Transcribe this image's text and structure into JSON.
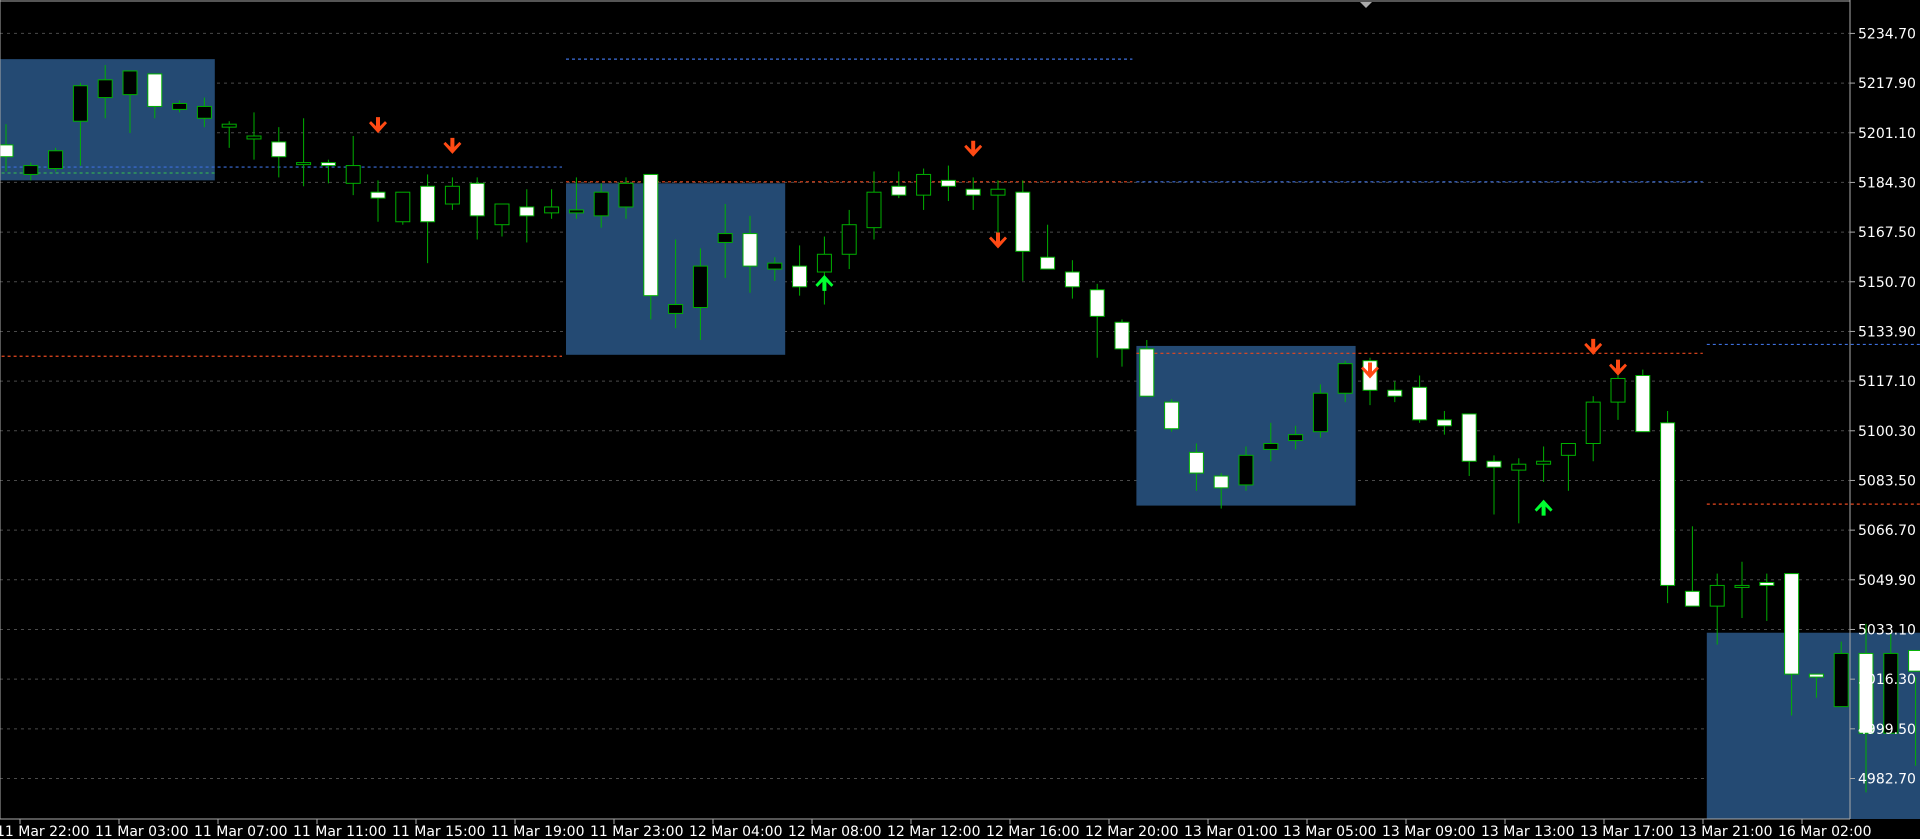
{
  "chart_data": {
    "type": "candlestick",
    "colors": {
      "background": "#000000",
      "bull_body": "#000000",
      "bear_body": "#ffffff",
      "wick": "#00b000",
      "grid": "#4a4a4a",
      "zone": "#244a73",
      "level_blue": "#3d6fdc",
      "level_red": "#e8481f",
      "level_green": "#33aa55",
      "arrow_down": "#ff4a14",
      "arrow_up": "#00ff30",
      "text": "#ffffff",
      "axis": "#aaaaaa"
    },
    "ylim": [
      4969,
      5246
    ],
    "y_ticks": [
      "5234.70",
      "5217.90",
      "5201.10",
      "5184.30",
      "5167.50",
      "5150.70",
      "5133.90",
      "5117.10",
      "5100.30",
      "5083.50",
      "5066.70",
      "5049.90",
      "5033.10",
      "5016.30",
      "4999.50",
      "4982.70"
    ],
    "x_ticks": [
      "11 Mar 22:00",
      "11 Mar 03:00",
      "11 Mar 07:00",
      "11 Mar 11:00",
      "11 Mar 15:00",
      "11 Mar 19:00",
      "11 Mar 23:00",
      "12 Mar 04:00",
      "12 Mar 08:00",
      "12 Mar 12:00",
      "12 Mar 16:00",
      "12 Mar 20:00",
      "13 Mar 01:00",
      "13 Mar 05:00",
      "13 Mar 09:00",
      "13 Mar 13:00",
      "13 Mar 17:00",
      "13 Mar 21:00",
      "16 Mar 02:00"
    ],
    "candles": [
      [
        5197,
        5204,
        5188,
        5193
      ],
      [
        5187,
        5191,
        5185,
        5190
      ],
      [
        5189,
        5196,
        5188,
        5195
      ],
      [
        5205,
        5218,
        5190,
        5217
      ],
      [
        5213,
        5224,
        5206,
        5219
      ],
      [
        5214,
        5222,
        5201,
        5222
      ],
      [
        5221,
        5221,
        5206,
        5210
      ],
      [
        5209,
        5212,
        5208,
        5211
      ],
      [
        5206,
        5213,
        5203,
        5210
      ],
      [
        5203,
        5205,
        5196,
        5204
      ],
      [
        5199,
        5208,
        5192,
        5200
      ],
      [
        5198,
        5203,
        5186,
        5193
      ],
      [
        5191,
        5206,
        5183,
        5191
      ],
      [
        5191,
        5192,
        5184,
        5190
      ],
      [
        5184,
        5200,
        5180,
        5190
      ],
      [
        5181,
        5185,
        5171,
        5179
      ],
      [
        5171,
        5181,
        5170,
        5181
      ],
      [
        5183,
        5187,
        5157,
        5171
      ],
      [
        5177,
        5186,
        5175,
        5183
      ],
      [
        5184,
        5186,
        5165,
        5173
      ],
      [
        5170,
        5177,
        5166,
        5177
      ],
      [
        5176,
        5182,
        5164,
        5173
      ],
      [
        5174,
        5182,
        5172,
        5176
      ],
      [
        5174,
        5186,
        5172,
        5175
      ],
      [
        5173,
        5184,
        5169,
        5181
      ],
      [
        5176,
        5186,
        5172,
        5184
      ],
      [
        5187,
        5184,
        5138,
        5146
      ],
      [
        5140,
        5165,
        5135,
        5143
      ],
      [
        5142,
        5162,
        5131,
        5156
      ],
      [
        5164,
        5177,
        5152,
        5167
      ],
      [
        5167,
        5173,
        5147,
        5156
      ],
      [
        5155,
        5159,
        5151,
        5157
      ],
      [
        5156,
        5163,
        5146,
        5149
      ],
      [
        5154,
        5166,
        5143,
        5160
      ],
      [
        5160,
        5175,
        5155,
        5170
      ],
      [
        5169,
        5188,
        5165,
        5181
      ],
      [
        5183,
        5188,
        5179,
        5180
      ],
      [
        5180,
        5189,
        5175,
        5187
      ],
      [
        5185,
        5190,
        5178,
        5183
      ],
      [
        5182,
        5186,
        5175,
        5180
      ],
      [
        5180,
        5185,
        5167,
        5182
      ],
      [
        5181,
        5185,
        5151,
        5161
      ],
      [
        5159,
        5170,
        5155,
        5155
      ],
      [
        5154,
        5158,
        5145,
        5149
      ],
      [
        5148,
        5150,
        5125,
        5139
      ],
      [
        5137,
        5138,
        5122,
        5128
      ],
      [
        5128,
        5131,
        5112,
        5112
      ],
      [
        5110,
        5111,
        5100,
        5101
      ],
      [
        5093,
        5096,
        5080,
        5086
      ],
      [
        5085,
        5086,
        5074,
        5081
      ],
      [
        5082,
        5095,
        5080,
        5092
      ],
      [
        5094,
        5103,
        5090,
        5096
      ],
      [
        5097,
        5102,
        5094,
        5099
      ],
      [
        5100,
        5116,
        5098,
        5113
      ],
      [
        5113,
        5124,
        5110,
        5123
      ],
      [
        5124,
        5125,
        5109,
        5114
      ],
      [
        5114,
        5117,
        5110,
        5112
      ],
      [
        5115,
        5119,
        5103,
        5104
      ],
      [
        5104,
        5107,
        5099,
        5102
      ],
      [
        5106,
        5105,
        5085,
        5090
      ],
      [
        5090,
        5092,
        5072,
        5088
      ],
      [
        5087,
        5091,
        5069,
        5089
      ],
      [
        5089,
        5095,
        5083,
        5090
      ],
      [
        5092,
        5096,
        5080,
        5096
      ],
      [
        5096,
        5112,
        5090,
        5110
      ],
      [
        5110,
        5124,
        5104,
        5118
      ],
      [
        5119,
        5121,
        5101,
        5100
      ],
      [
        5103,
        5107,
        5042,
        5048
      ],
      [
        5046,
        5068,
        5041,
        5041
      ],
      [
        5041,
        5052,
        5028,
        5048
      ],
      [
        5048,
        5056,
        5037,
        5048
      ],
      [
        5049,
        5052,
        5036,
        5048
      ],
      [
        5052,
        5050,
        5004,
        5018
      ],
      [
        5018,
        5018,
        5010,
        5017
      ],
      [
        5007,
        5029,
        5009,
        5025
      ],
      [
        5025,
        5035,
        4978,
        4998
      ],
      [
        4998,
        5032,
        4998,
        5025
      ],
      [
        5026,
        5017,
        4987,
        5019
      ],
      [
        5019,
        5008,
        5008,
        5007
      ]
    ],
    "zones": [
      {
        "from": 0,
        "to": 8,
        "top": 5226,
        "bottom": 5185
      },
      {
        "from": 23,
        "to": 31,
        "top": 5184,
        "bottom": 5126
      },
      {
        "from": 46,
        "to": 54,
        "top": 5129,
        "bottom": 5075
      },
      {
        "from": 69,
        "to": 78,
        "top": 5032,
        "bottom": 4969
      }
    ],
    "levels": [
      {
        "value": 5189.5,
        "from": 0,
        "to": 22,
        "style": "blue"
      },
      {
        "value": 5187.5,
        "from": 0,
        "to": 8,
        "style": "green"
      },
      {
        "value": 5125.5,
        "from": 0,
        "to": 22,
        "style": "red"
      },
      {
        "value": 5226,
        "from": 23,
        "to": 45,
        "style": "blue"
      },
      {
        "value": 5184.5,
        "from": 23,
        "to": 45,
        "style": "red"
      },
      {
        "value": 5184.5,
        "from": 46,
        "to": 68,
        "style": "blue"
      },
      {
        "value": 5126.5,
        "from": 46,
        "to": 68,
        "style": "red"
      },
      {
        "value": 5129.5,
        "from": 69,
        "to": 78,
        "style": "blue"
      },
      {
        "value": 5075.5,
        "from": 69,
        "to": 78,
        "style": "red"
      }
    ],
    "arrows": [
      {
        "index": 15,
        "dir": "down",
        "price": 5203
      },
      {
        "index": 18,
        "dir": "down",
        "price": 5196
      },
      {
        "index": 33,
        "dir": "up",
        "price": 5151
      },
      {
        "index": 39,
        "dir": "down",
        "price": 5195
      },
      {
        "index": 40,
        "dir": "down",
        "price": 5164
      },
      {
        "index": 55,
        "dir": "down",
        "price": 5120
      },
      {
        "index": 62,
        "dir": "up",
        "price": 5075
      },
      {
        "index": 64,
        "dir": "down",
        "price": 5128
      },
      {
        "index": 65,
        "dir": "down",
        "price": 5121
      }
    ],
    "grid": true,
    "legend": "none"
  }
}
